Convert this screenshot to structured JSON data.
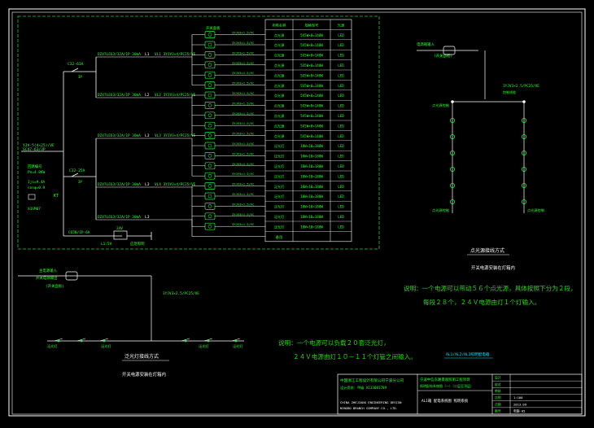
{
  "colors": {
    "background": "#000000",
    "wire": "#ffffff",
    "component": "#2fe84a",
    "label": "#33ff33",
    "frame": "#ffffff",
    "dashed": "#22c84a",
    "cyan": "#00e5ff",
    "note": "#32d11f"
  },
  "main_panel": {
    "incoming_label_1": "YJV-5(4×25)/VE",
    "incoming_label_2": "SC47-63/3P",
    "incoming_label_3": "回路编号",
    "incoming_label_4": "Pe=4.8KW",
    "incoming_label_5": "Ijs=9.4A",
    "incoming_label_6": "cosφ=0.9",
    "incoming_label_7": "X3SM07",
    "feeder_node_label": "KT",
    "breaker_top": "C32-63A",
    "breaker_top_sub": "3P",
    "breaker_mid": "C32-25A",
    "breaker_mid_sub": "3P",
    "breaker_bottom": "C65N/1P-6A",
    "transformer_label": "L1:5V",
    "transformer_label_2": "24V",
    "transformer_note": "应急照明",
    "circuits": [
      {
        "breaker": "DZ47LE63/32A/1P 30mA",
        "phase": "L1",
        "cable": "VL1  3YJV3×4/PC25/VE"
      },
      {
        "breaker": "DZ47LE63/32A/1P 30mA",
        "phase": "L2",
        "cable": "VL2  3YJV3×4/PC25/VE"
      },
      {
        "breaker": "DZ47LE63/32A/1P 30mA",
        "phase": "L3",
        "cable": "VL3  3YJV3×4/PC25/VE"
      },
      {
        "breaker": "DZ47LE63/32A/1P 30mA",
        "phase": "L3",
        "cable": "VL4  3YJV3×4/PC25/VE"
      },
      {
        "breaker": "DZ47LE63/32A/1P 30mA",
        "phase": "L3",
        "cable": ""
      }
    ],
    "switch_tag": "开关面板",
    "wire_tag": "3YJV3×1.5/VC",
    "table_header": [
      "用电名称",
      "规格型号",
      "光源"
    ],
    "table_rows": [
      [
        "点光源",
        "5X5W×0=140W",
        "LED"
      ],
      [
        "点光源",
        "5X5W×0=140W",
        "LED"
      ],
      [
        "点光源",
        "5X5W×0=140W",
        "LED"
      ],
      [
        "点光源",
        "5X5W×0=140W",
        "LED"
      ],
      [
        "点光源",
        "5X5W×0=140W",
        "LED"
      ],
      [
        "点光源",
        "5X5W×0=140W",
        "LED"
      ],
      [
        "点光源",
        "5X5W×0=140W",
        "LED"
      ],
      [
        "点光源",
        "5X5W×0=140W",
        "LED"
      ],
      [
        "点光源",
        "5X5W×0=140W",
        "LED"
      ],
      [
        "点光源",
        "5X5W×0=140W",
        "LED"
      ],
      [
        "点光源",
        "5X5W×0=140W",
        "LED"
      ],
      [
        "泛光灯",
        "18W×10=180W",
        "LED"
      ],
      [
        "泛光灯",
        "18W×10=180W",
        "LED"
      ],
      [
        "泛光灯",
        "18W×10=180W",
        "LED"
      ],
      [
        "泛光灯",
        "18W×10=180W",
        "LED"
      ],
      [
        "泛光灯",
        "18W×10=180W",
        "LED"
      ],
      [
        "泛光灯",
        "18W×10=180W",
        "LED"
      ],
      [
        "泛光灯",
        "18W×10=180W",
        "LED"
      ],
      [
        "泛光灯",
        "18W×10=180W",
        "LED"
      ],
      [
        "泛光灯",
        "18W×10=180W",
        "LED"
      ],
      [
        "备用",
        "",
        ""
      ]
    ]
  },
  "point_light_diagram": {
    "top_label": "电源箱输入",
    "top_label_sub": "(开关面板)",
    "cable_label": "3YJV3×2.5/PC25/VE",
    "cable_sub": "控制线缆",
    "left_node": "点光源控制",
    "bottom_left": "点光源控制",
    "bottom_right": "点光源控制",
    "title": "点光源接线方式",
    "subtitle": "开关电源安装在灯箱内"
  },
  "flood_diagram": {
    "top_label": "主电源输入",
    "top_sub_1": "开关电源输出",
    "top_sub_2": "(开关面板)",
    "cable_label": "3YJV3×2.5/PC25/VE",
    "left_end": "泛光灯",
    "left_mid": "泛光灯",
    "right_mid": "泛光灯",
    "right_end": "泛光灯",
    "title": "泛光灯接线方式",
    "subtitle": "开关电源安装在灯箱内"
  },
  "notes": {
    "n1_line1": "说明：一个电源可以带动５６个点光源，具体按照下分为２段，",
    "n1_line2": "每段２８个，２４Ｖ电源由灯１个灯输入。",
    "n2_line1": "说明：一个电源可以负载２０套泛光灯，",
    "n2_line2": "２４Ｖ电源由灯１０－１１个灯管之间输入。",
    "cyan_tag": "AL1/AL2/AL3照明配电箱"
  },
  "title_block": {
    "company": "中国浙江工程设计有限公司宁波分公司",
    "company_en_1": "CHINA ZHEJIANG ENGINEERING DESIGN",
    "company_en_2": "NINGBO BRANCH COMPANY CO., LTD.",
    "cert": "设计资质：甲级 A133001789",
    "project_1": "宁波中信东路景观照明工程项目",
    "project_2": "照明配电系统图（一）（二层至顶层）",
    "drawing_name": "AL1箱 配电系统图 照明系统",
    "fields": [
      "设计",
      "校对",
      "审核",
      "比例",
      "日期",
      "图号"
    ],
    "field_values": [
      "",
      "",
      "",
      "1:100",
      "2013.09",
      "电施-05"
    ]
  }
}
